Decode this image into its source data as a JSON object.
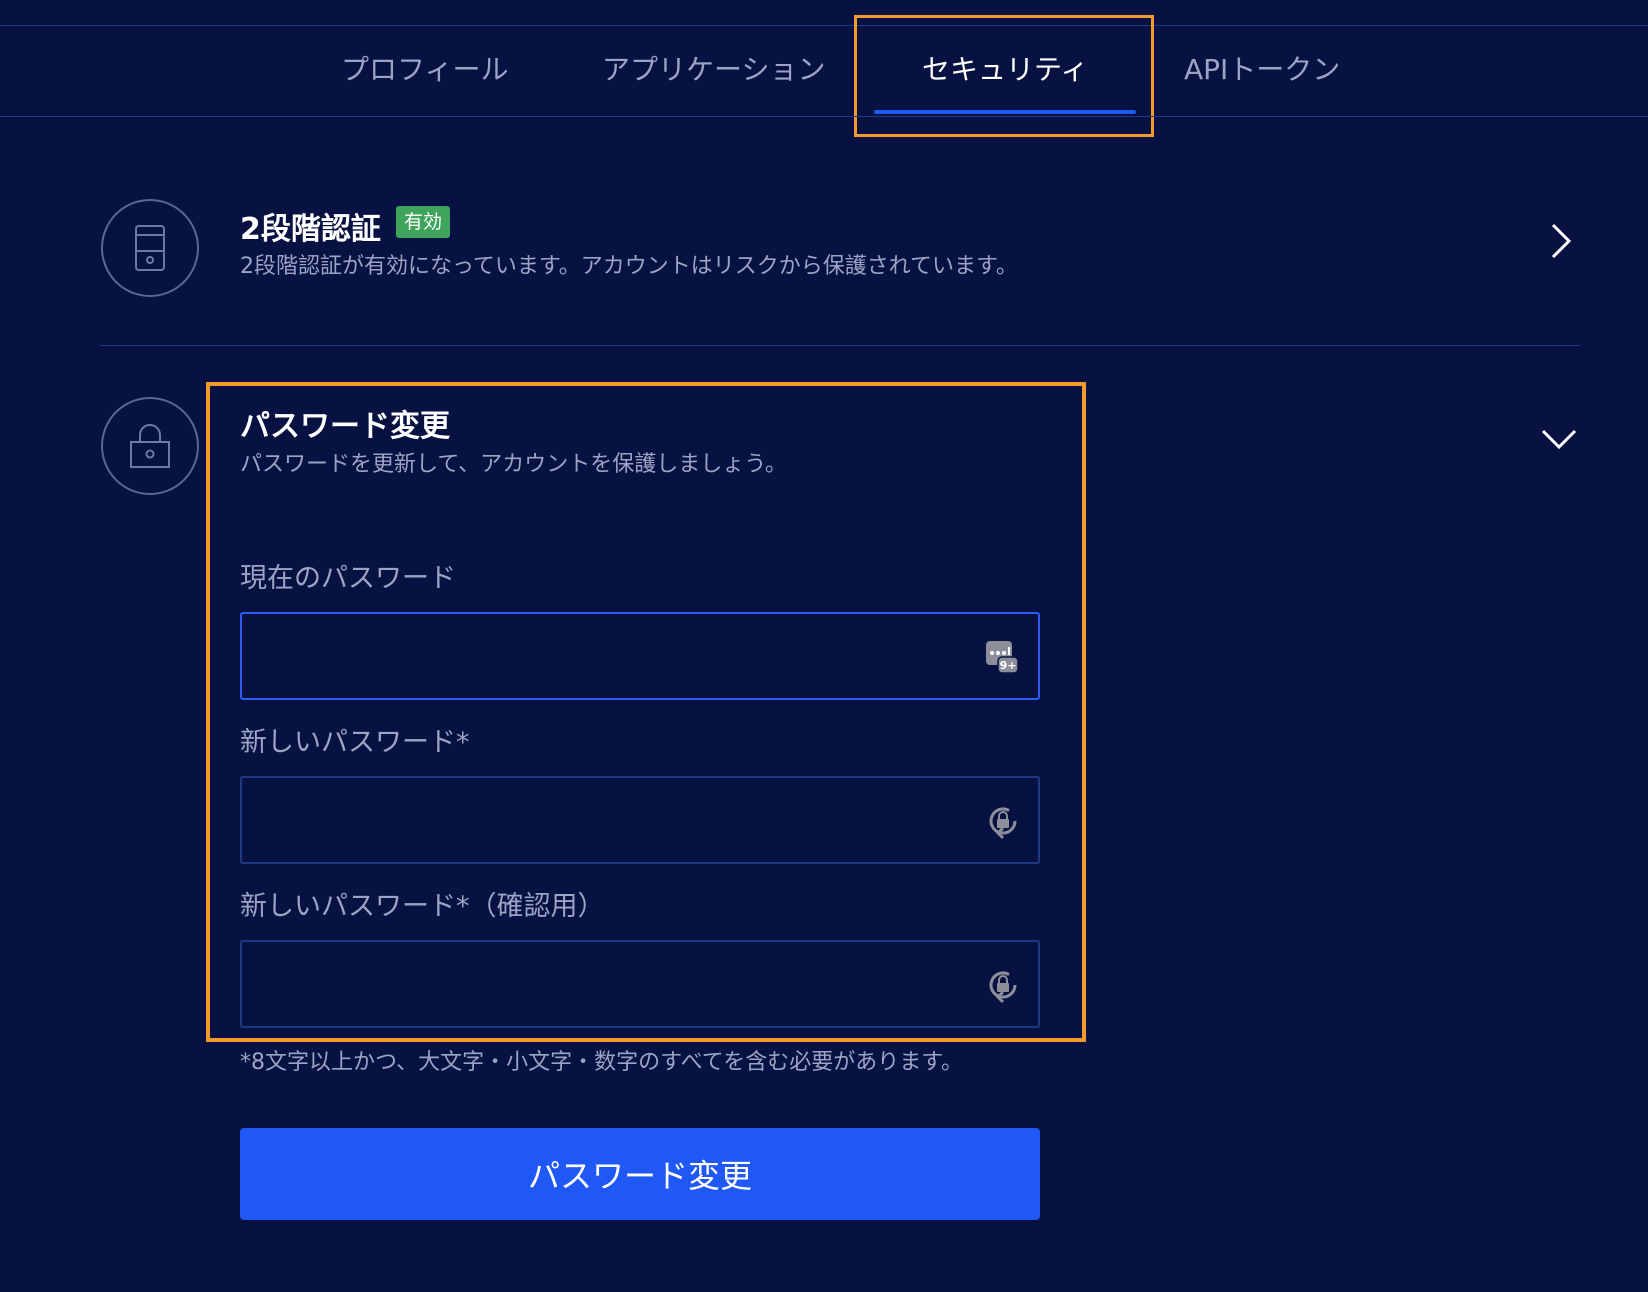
{
  "tabs": [
    {
      "label": "プロフィール"
    },
    {
      "label": "アプリケーション"
    },
    {
      "label": "セキュリティ"
    },
    {
      "label": "APIトークン"
    }
  ],
  "two_factor": {
    "title": "2段階認証",
    "badge": "有効",
    "description": "2段階認証が有効になっています。アカウントはリスクから保護されています。"
  },
  "password_change": {
    "title": "パスワード変更",
    "description": "パスワードを更新して、アカウントを保護しましょう。",
    "current_label": "現在のパスワード",
    "current_value": "",
    "new_label": "新しいパスワード*",
    "new_value": "",
    "confirm_label": "新しいパスワード*（確認用）",
    "confirm_value": "",
    "hint": "*8文字以上かつ、大文字・小文字・数字のすべてを含む必要があります。",
    "submit_label": "パスワード変更"
  },
  "colors": {
    "background": "#071243",
    "accent": "#2058f5",
    "highlight": "#f39a2c",
    "badge": "#3fa45b"
  },
  "icons": {
    "two_factor": "phone-icon",
    "password": "lock-icon",
    "expand_2fa": "chevron-right-icon",
    "expand_password": "chevron-down-icon",
    "password_manager": "password-manager-icon",
    "generate_password": "lock-refresh-icon"
  }
}
